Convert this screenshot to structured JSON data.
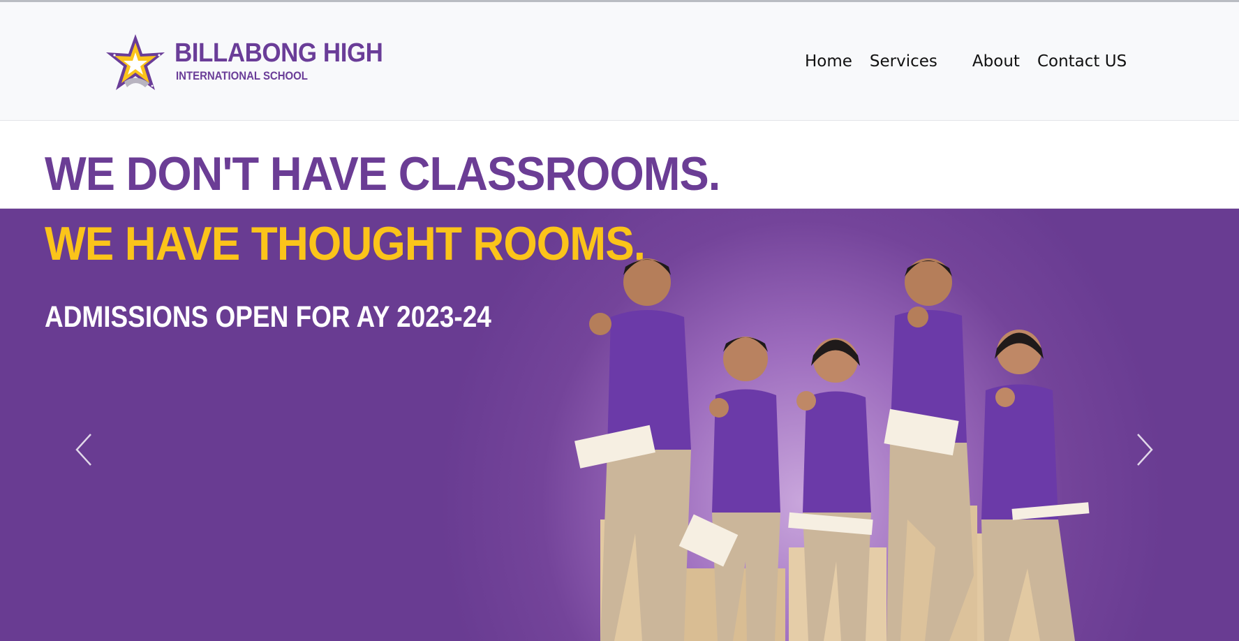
{
  "brand": {
    "name": "BILLABONG HIGH",
    "tagline": "INTERNATIONAL SCHOOL",
    "colors": {
      "purple": "#6a3d98",
      "yellow": "#fbc41a",
      "grey": "#b8b4c0"
    }
  },
  "nav": {
    "items": [
      {
        "label": "Home"
      },
      {
        "label": "Services"
      },
      {
        "label": "About"
      },
      {
        "label": "Contact US"
      }
    ]
  },
  "hero": {
    "line1": "WE DON'T HAVE CLASSROOMS.",
    "line2": "WE HAVE THOUGHT ROOMS.",
    "line3": "ADMISSIONS OPEN FOR AY 2023-24",
    "colors": {
      "background": "#693c92",
      "highlight": "#fbc41a",
      "line1": "#6b3d95"
    },
    "carousel": {
      "prev_icon": "chevron-left-icon",
      "next_icon": "chevron-right-icon"
    }
  }
}
